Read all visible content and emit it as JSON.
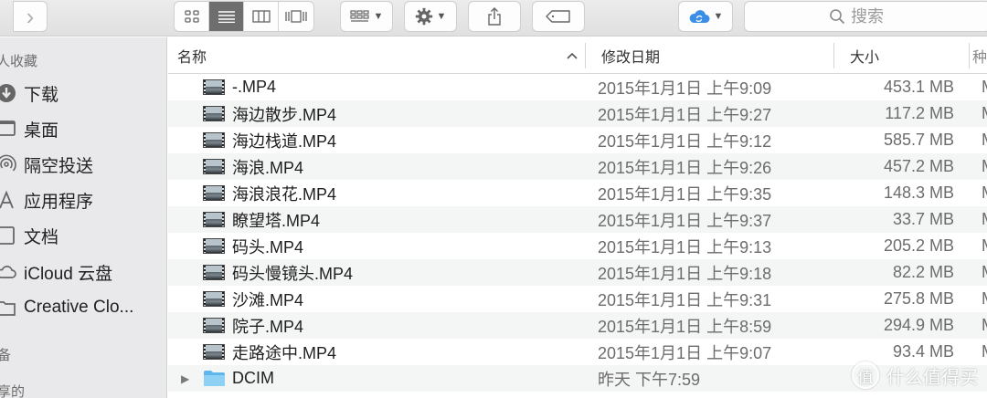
{
  "toolbar": {
    "nav_forward_glyph": "›",
    "action_glyph": "⇪"
  },
  "search": {
    "placeholder": "搜索"
  },
  "sidebar": {
    "section_favorites": "人收藏",
    "items": [
      {
        "label": "下载",
        "icon": "download-icon"
      },
      {
        "label": "桌面",
        "icon": "desktop-icon"
      },
      {
        "label": "隔空投送",
        "icon": "airdrop-icon"
      },
      {
        "label": "应用程序",
        "icon": "applications-icon"
      },
      {
        "label": "文档",
        "icon": "documents-icon"
      },
      {
        "label": "iCloud 云盘",
        "icon": "icloud-icon"
      },
      {
        "label": "Creative Clo...",
        "icon": "folder-icon"
      }
    ],
    "section_devices": "备",
    "section_shared": "享的"
  },
  "columns": {
    "name": "名称",
    "date": "修改日期",
    "size": "大小",
    "kind": "种"
  },
  "files": [
    {
      "name": "-.MP4",
      "date": "2015年1月1日 上午9:09",
      "size": "453.1 MB",
      "kind": "M"
    },
    {
      "name": "海边散步.MP4",
      "date": "2015年1月1日 上午9:27",
      "size": "117.2 MB",
      "kind": "M"
    },
    {
      "name": "海边栈道.MP4",
      "date": "2015年1月1日 上午9:12",
      "size": "585.7 MB",
      "kind": "M"
    },
    {
      "name": "海浪.MP4",
      "date": "2015年1月1日 上午9:26",
      "size": "457.2 MB",
      "kind": "M"
    },
    {
      "name": "海浪浪花.MP4",
      "date": "2015年1月1日 上午9:35",
      "size": "148.3 MB",
      "kind": "M"
    },
    {
      "name": "瞭望塔.MP4",
      "date": "2015年1月1日 上午9:37",
      "size": "33.7 MB",
      "kind": "M"
    },
    {
      "name": "码头.MP4",
      "date": "2015年1月1日 上午9:13",
      "size": "205.2 MB",
      "kind": "M"
    },
    {
      "name": "码头慢镜头.MP4",
      "date": "2015年1月1日 上午9:18",
      "size": "82.2 MB",
      "kind": "M"
    },
    {
      "name": "沙滩.MP4",
      "date": "2015年1月1日 上午9:31",
      "size": "275.8 MB",
      "kind": "M"
    },
    {
      "name": "院子.MP4",
      "date": "2015年1月1日 上午8:59",
      "size": "294.9 MB",
      "kind": "M"
    },
    {
      "name": "走路途中.MP4",
      "date": "2015年1月1日 上午9:07",
      "size": "93.4 MB",
      "kind": "M"
    }
  ],
  "folder_row": {
    "name": "DCIM",
    "date": "昨天 下午7:59"
  },
  "watermark": {
    "mark": "值",
    "text": "什么值得买"
  },
  "colors": {
    "folder": "#5fb6ea",
    "selected_view": "#6e6e6e",
    "icloud": "#3a8ee6"
  }
}
